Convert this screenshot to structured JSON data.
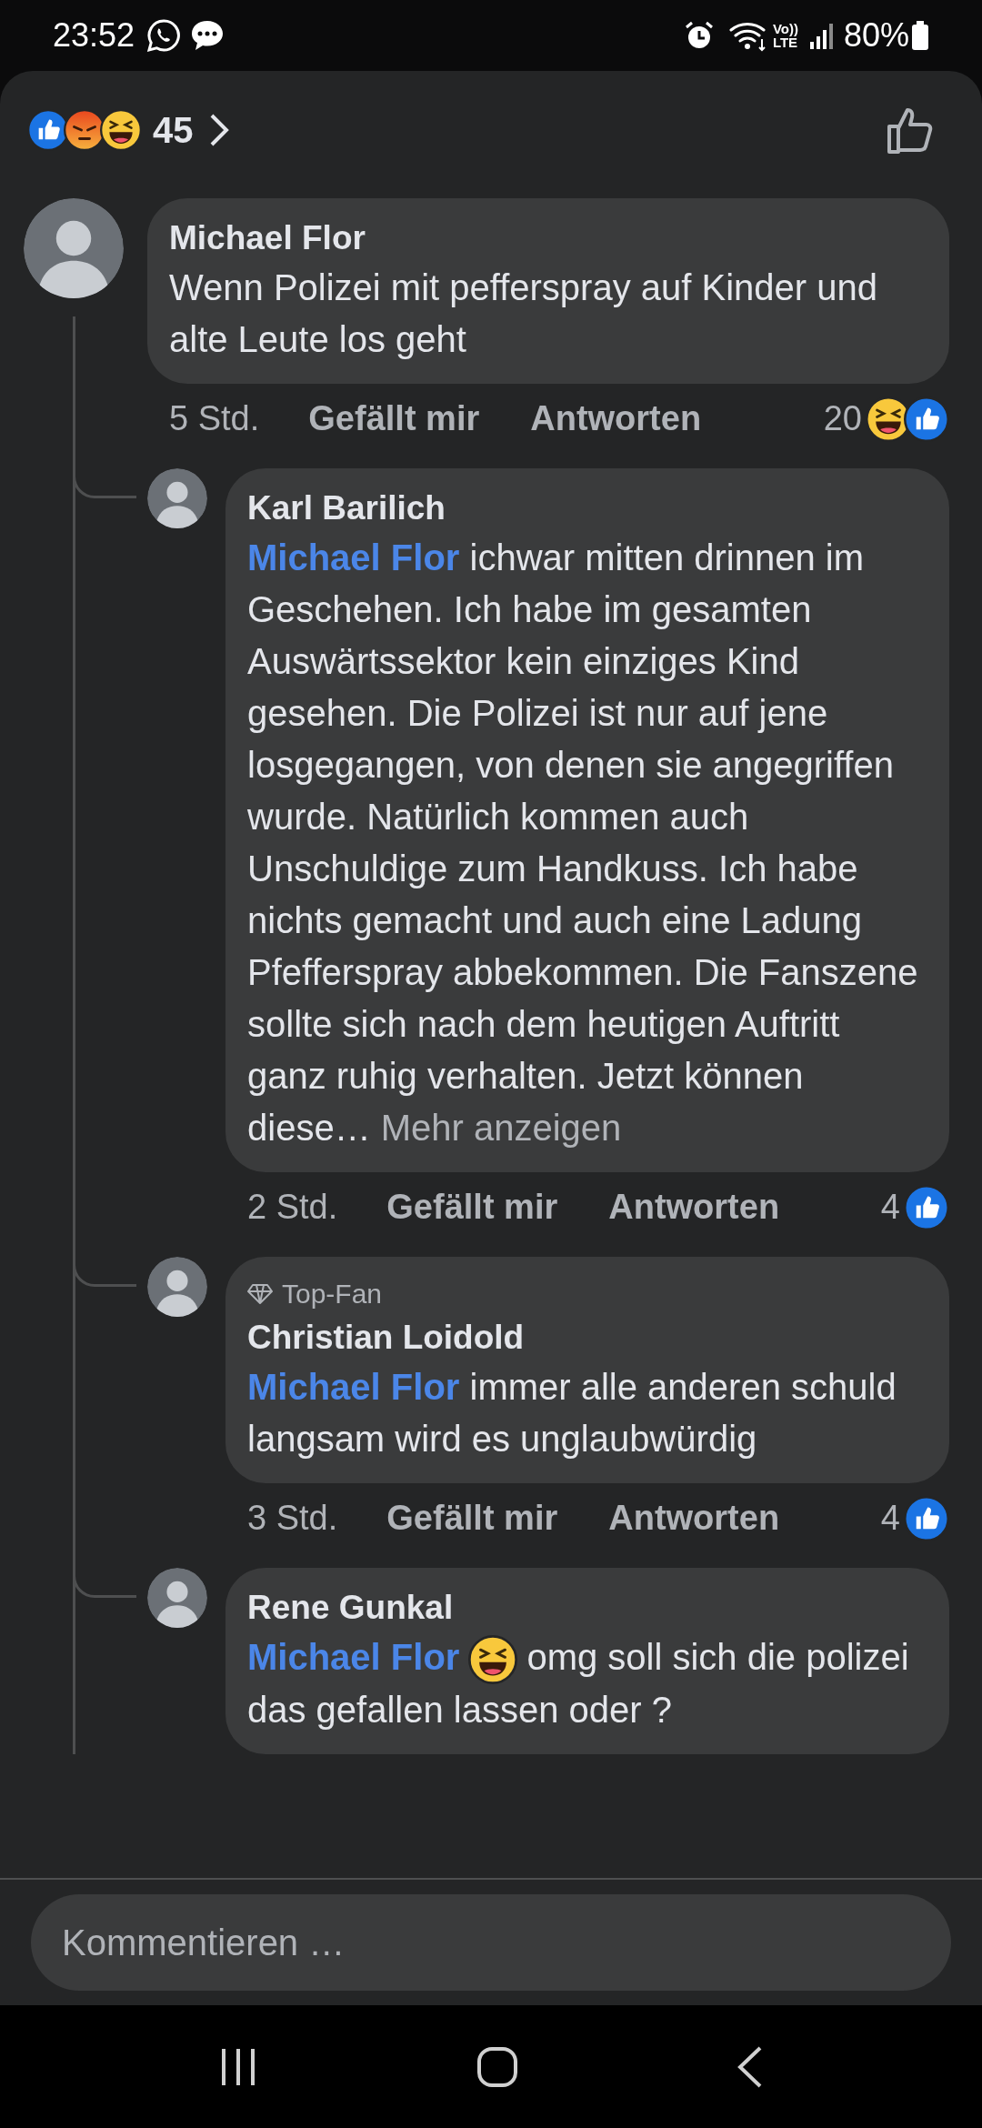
{
  "status_bar": {
    "time": "23:52",
    "volte_top": "Vo))",
    "volte_bottom": "LTE",
    "battery": "80%"
  },
  "header": {
    "reactions": [
      {
        "kind": "like"
      },
      {
        "kind": "angry"
      },
      {
        "kind": "haha"
      }
    ],
    "count": "45"
  },
  "comments": [
    {
      "author": "Michael Flor",
      "text": "Wenn Polizei mit pefferspray auf Kinder und alte Leute los geht",
      "time": "5 Std.",
      "like": "Gefällt mir",
      "reply": "Antworten",
      "count": "20",
      "reactions": [
        {
          "kind": "haha"
        },
        {
          "kind": "like"
        }
      ],
      "replies": [
        {
          "author": "Karl Barilich",
          "mention": "Michael Flor",
          "text": "ichwar mitten drinnen im Geschehen.  Ich habe im gesamten Auswärtssektor kein einziges Kind gesehen. Die Polizei ist nur auf jene losgegangen,  von denen sie angegriffen wurde. Natürlich kommen auch Unschuldige zum Handkuss. Ich habe nichts gemacht und auch eine Ladung Pfefferspray abbekommen. Die Fanszene sollte sich nach dem heutigen Auftritt ganz ruhig verhalten. Jetzt können diese…",
          "more": "Mehr anzeigen",
          "time": "2 Std.",
          "like": "Gefällt mir",
          "reply": "Antworten",
          "count": "4",
          "reactions": [
            {
              "kind": "like"
            }
          ]
        },
        {
          "badge": "Top-Fan",
          "author": "Christian Loidold",
          "mention": "Michael Flor",
          "text": "immer alle anderen schuld langsam wird es unglaubwürdig",
          "time": "3 Std.",
          "like": "Gefällt mir",
          "reply": "Antworten",
          "count": "4",
          "reactions": [
            {
              "kind": "like"
            }
          ]
        },
        {
          "author": "Rene Gunkal",
          "mention": "Michael Flor",
          "emoji": true,
          "text": "omg soll sich die polizei das gefallen lassen oder ?"
        }
      ]
    }
  ],
  "composer": {
    "placeholder": "Kommentieren …"
  }
}
